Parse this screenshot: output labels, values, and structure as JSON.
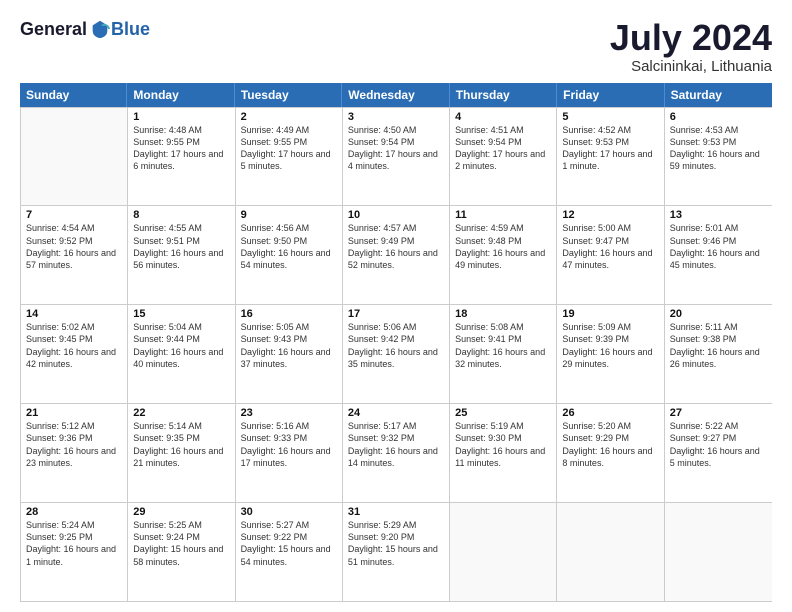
{
  "logo": {
    "general": "General",
    "blue": "Blue"
  },
  "title": {
    "month_year": "July 2024",
    "location": "Salcininkai, Lithuania"
  },
  "days": [
    "Sunday",
    "Monday",
    "Tuesday",
    "Wednesday",
    "Thursday",
    "Friday",
    "Saturday"
  ],
  "weeks": [
    [
      {
        "date": "",
        "sunrise": "",
        "sunset": "",
        "daylight": ""
      },
      {
        "date": "1",
        "sunrise": "Sunrise: 4:48 AM",
        "sunset": "Sunset: 9:55 PM",
        "daylight": "Daylight: 17 hours and 6 minutes."
      },
      {
        "date": "2",
        "sunrise": "Sunrise: 4:49 AM",
        "sunset": "Sunset: 9:55 PM",
        "daylight": "Daylight: 17 hours and 5 minutes."
      },
      {
        "date": "3",
        "sunrise": "Sunrise: 4:50 AM",
        "sunset": "Sunset: 9:54 PM",
        "daylight": "Daylight: 17 hours and 4 minutes."
      },
      {
        "date": "4",
        "sunrise": "Sunrise: 4:51 AM",
        "sunset": "Sunset: 9:54 PM",
        "daylight": "Daylight: 17 hours and 2 minutes."
      },
      {
        "date": "5",
        "sunrise": "Sunrise: 4:52 AM",
        "sunset": "Sunset: 9:53 PM",
        "daylight": "Daylight: 17 hours and 1 minute."
      },
      {
        "date": "6",
        "sunrise": "Sunrise: 4:53 AM",
        "sunset": "Sunset: 9:53 PM",
        "daylight": "Daylight: 16 hours and 59 minutes."
      }
    ],
    [
      {
        "date": "7",
        "sunrise": "Sunrise: 4:54 AM",
        "sunset": "Sunset: 9:52 PM",
        "daylight": "Daylight: 16 hours and 57 minutes."
      },
      {
        "date": "8",
        "sunrise": "Sunrise: 4:55 AM",
        "sunset": "Sunset: 9:51 PM",
        "daylight": "Daylight: 16 hours and 56 minutes."
      },
      {
        "date": "9",
        "sunrise": "Sunrise: 4:56 AM",
        "sunset": "Sunset: 9:50 PM",
        "daylight": "Daylight: 16 hours and 54 minutes."
      },
      {
        "date": "10",
        "sunrise": "Sunrise: 4:57 AM",
        "sunset": "Sunset: 9:49 PM",
        "daylight": "Daylight: 16 hours and 52 minutes."
      },
      {
        "date": "11",
        "sunrise": "Sunrise: 4:59 AM",
        "sunset": "Sunset: 9:48 PM",
        "daylight": "Daylight: 16 hours and 49 minutes."
      },
      {
        "date": "12",
        "sunrise": "Sunrise: 5:00 AM",
        "sunset": "Sunset: 9:47 PM",
        "daylight": "Daylight: 16 hours and 47 minutes."
      },
      {
        "date": "13",
        "sunrise": "Sunrise: 5:01 AM",
        "sunset": "Sunset: 9:46 PM",
        "daylight": "Daylight: 16 hours and 45 minutes."
      }
    ],
    [
      {
        "date": "14",
        "sunrise": "Sunrise: 5:02 AM",
        "sunset": "Sunset: 9:45 PM",
        "daylight": "Daylight: 16 hours and 42 minutes."
      },
      {
        "date": "15",
        "sunrise": "Sunrise: 5:04 AM",
        "sunset": "Sunset: 9:44 PM",
        "daylight": "Daylight: 16 hours and 40 minutes."
      },
      {
        "date": "16",
        "sunrise": "Sunrise: 5:05 AM",
        "sunset": "Sunset: 9:43 PM",
        "daylight": "Daylight: 16 hours and 37 minutes."
      },
      {
        "date": "17",
        "sunrise": "Sunrise: 5:06 AM",
        "sunset": "Sunset: 9:42 PM",
        "daylight": "Daylight: 16 hours and 35 minutes."
      },
      {
        "date": "18",
        "sunrise": "Sunrise: 5:08 AM",
        "sunset": "Sunset: 9:41 PM",
        "daylight": "Daylight: 16 hours and 32 minutes."
      },
      {
        "date": "19",
        "sunrise": "Sunrise: 5:09 AM",
        "sunset": "Sunset: 9:39 PM",
        "daylight": "Daylight: 16 hours and 29 minutes."
      },
      {
        "date": "20",
        "sunrise": "Sunrise: 5:11 AM",
        "sunset": "Sunset: 9:38 PM",
        "daylight": "Daylight: 16 hours and 26 minutes."
      }
    ],
    [
      {
        "date": "21",
        "sunrise": "Sunrise: 5:12 AM",
        "sunset": "Sunset: 9:36 PM",
        "daylight": "Daylight: 16 hours and 23 minutes."
      },
      {
        "date": "22",
        "sunrise": "Sunrise: 5:14 AM",
        "sunset": "Sunset: 9:35 PM",
        "daylight": "Daylight: 16 hours and 21 minutes."
      },
      {
        "date": "23",
        "sunrise": "Sunrise: 5:16 AM",
        "sunset": "Sunset: 9:33 PM",
        "daylight": "Daylight: 16 hours and 17 minutes."
      },
      {
        "date": "24",
        "sunrise": "Sunrise: 5:17 AM",
        "sunset": "Sunset: 9:32 PM",
        "daylight": "Daylight: 16 hours and 14 minutes."
      },
      {
        "date": "25",
        "sunrise": "Sunrise: 5:19 AM",
        "sunset": "Sunset: 9:30 PM",
        "daylight": "Daylight: 16 hours and 11 minutes."
      },
      {
        "date": "26",
        "sunrise": "Sunrise: 5:20 AM",
        "sunset": "Sunset: 9:29 PM",
        "daylight": "Daylight: 16 hours and 8 minutes."
      },
      {
        "date": "27",
        "sunrise": "Sunrise: 5:22 AM",
        "sunset": "Sunset: 9:27 PM",
        "daylight": "Daylight: 16 hours and 5 minutes."
      }
    ],
    [
      {
        "date": "28",
        "sunrise": "Sunrise: 5:24 AM",
        "sunset": "Sunset: 9:25 PM",
        "daylight": "Daylight: 16 hours and 1 minute."
      },
      {
        "date": "29",
        "sunrise": "Sunrise: 5:25 AM",
        "sunset": "Sunset: 9:24 PM",
        "daylight": "Daylight: 15 hours and 58 minutes."
      },
      {
        "date": "30",
        "sunrise": "Sunrise: 5:27 AM",
        "sunset": "Sunset: 9:22 PM",
        "daylight": "Daylight: 15 hours and 54 minutes."
      },
      {
        "date": "31",
        "sunrise": "Sunrise: 5:29 AM",
        "sunset": "Sunset: 9:20 PM",
        "daylight": "Daylight: 15 hours and 51 minutes."
      },
      {
        "date": "",
        "sunrise": "",
        "sunset": "",
        "daylight": ""
      },
      {
        "date": "",
        "sunrise": "",
        "sunset": "",
        "daylight": ""
      },
      {
        "date": "",
        "sunrise": "",
        "sunset": "",
        "daylight": ""
      }
    ]
  ]
}
